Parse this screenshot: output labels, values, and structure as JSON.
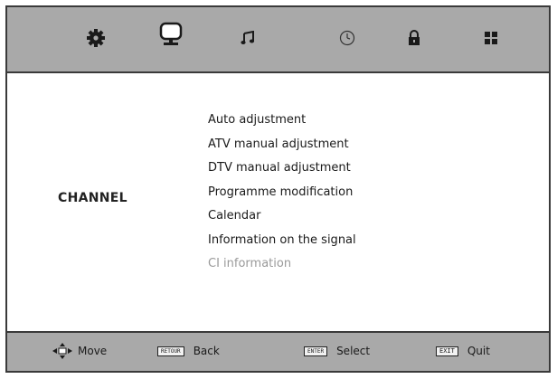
{
  "top_icons": [
    "settings-gear-icon",
    "tv-monitor-icon",
    "music-note-icon",
    "clock-icon",
    "padlock-icon",
    "four-squares-icon"
  ],
  "section": {
    "label": "CHANNEL"
  },
  "menu": {
    "items": [
      {
        "label": "Auto adjustment",
        "enabled": true
      },
      {
        "label": "ATV manual adjustment",
        "enabled": true
      },
      {
        "label": "DTV manual adjustment",
        "enabled": true
      },
      {
        "label": "Programme modification",
        "enabled": true
      },
      {
        "label": "Calendar",
        "enabled": true
      },
      {
        "label": "Information on the signal",
        "enabled": true
      },
      {
        "label": "CI information",
        "enabled": false
      }
    ]
  },
  "footer": {
    "move_label": "Move",
    "back_key": "RETOUR",
    "back_label": "Back",
    "select_key": "ENTER",
    "select_label": "Select",
    "quit_key": "EXIT",
    "quit_label": "Quit"
  },
  "colors": {
    "bar_gray": "#a9a9a9",
    "border": "#3a3a3a",
    "disabled_text": "#9a9a9a"
  }
}
